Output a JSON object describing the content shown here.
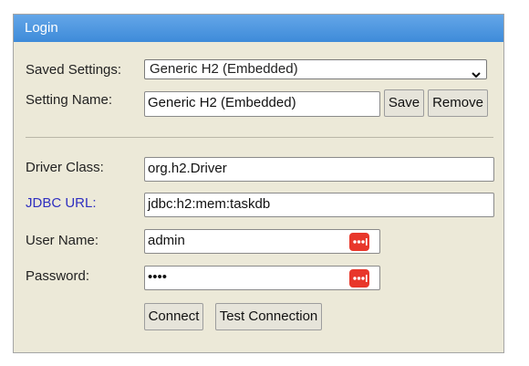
{
  "header": {
    "title": "Login"
  },
  "saved_settings": {
    "label": "Saved Settings:",
    "selected": "Generic H2 (Embedded)"
  },
  "setting_name": {
    "label": "Setting Name:",
    "value": "Generic H2 (Embedded)",
    "save_label": "Save",
    "remove_label": "Remove"
  },
  "driver_class": {
    "label": "Driver Class:",
    "value": "org.h2.Driver"
  },
  "jdbc_url": {
    "label": "JDBC URL:",
    "value": "jdbc:h2:mem:taskdb"
  },
  "user_name": {
    "label": "User Name:",
    "value": "admin"
  },
  "password": {
    "label": "Password:",
    "value": "••••"
  },
  "actions": {
    "connect_label": "Connect",
    "test_label": "Test Connection"
  },
  "colors": {
    "header_bg": "#4696e0",
    "panel_bg": "#ece9d8",
    "link_label": "#2f2fc0",
    "password_manager_icon": "#e8372b"
  },
  "icons": {
    "select_chevron": "chevron-down-icon",
    "password_manager": "password-manager-icon"
  }
}
